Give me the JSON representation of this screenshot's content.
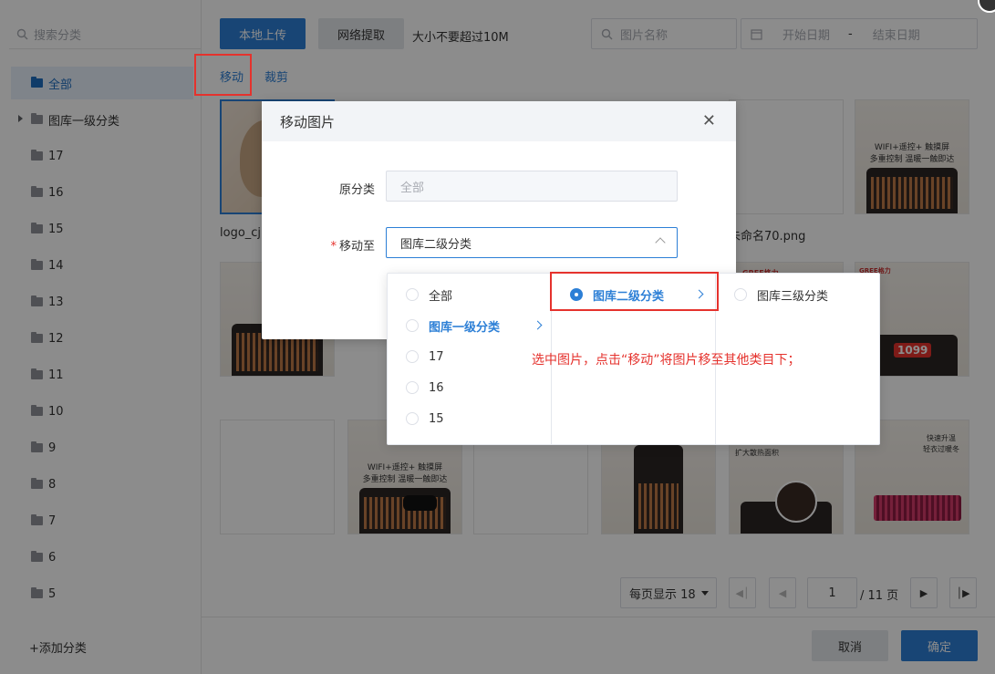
{
  "sidebar": {
    "search_placeholder": "搜索分类",
    "categories": [
      {
        "label": "全部",
        "active": true
      },
      {
        "label": "图库一级分类",
        "expandable": true
      },
      {
        "label": "17"
      },
      {
        "label": "16"
      },
      {
        "label": "15"
      },
      {
        "label": "14"
      },
      {
        "label": "13"
      },
      {
        "label": "12"
      },
      {
        "label": "11"
      },
      {
        "label": "10"
      },
      {
        "label": "9"
      },
      {
        "label": "8"
      },
      {
        "label": "7"
      },
      {
        "label": "6"
      },
      {
        "label": "5"
      }
    ],
    "add_category": "+添加分类"
  },
  "toolbar": {
    "upload_label": "本地上传",
    "fetch_label": "网络提取",
    "size_hint": "大小不要超过10M",
    "image_name_placeholder": "图片名称",
    "start_date_placeholder": "开始日期",
    "date_separator": "-",
    "end_date_placeholder": "结束日期"
  },
  "actions": {
    "move": "移动",
    "crop": "裁剪"
  },
  "thumbnails": {
    "name_1": "logo_cj",
    "name_2": "未命名70.png",
    "heater_caption_line1": "WIFI+遥控+ 触摸屏",
    "heater_caption_line2": "多重控制 温暖一触即达",
    "badge_1099": "1099",
    "brand": "GREE格力",
    "caption_expand": "扩大散热面积",
    "caption_fast_1": "快速升温",
    "caption_fast_2": "轻衣过暖冬"
  },
  "dialog": {
    "title": "移动图片",
    "close_icon": "close-icon",
    "source_label": "原分类",
    "source_value": "全部",
    "target_label": "移动至",
    "target_value": "图库二级分类"
  },
  "cascader": {
    "col1": [
      {
        "label": "全部"
      },
      {
        "label": "图库一级分类",
        "highlight": true
      },
      {
        "label": "17"
      },
      {
        "label": "16"
      },
      {
        "label": "15"
      }
    ],
    "col2": [
      {
        "label": "图库二级分类",
        "checked": true
      }
    ],
    "col3": [
      {
        "label": "图库三级分类"
      }
    ]
  },
  "annotation": "选中图片，点击“移动”将图片移至其他类目下；",
  "pagination": {
    "page_size_label": "每页显示 18",
    "current_page": "1",
    "total_pages": "/ 11 页"
  },
  "footer": {
    "cancel_label": "取消",
    "confirm_label": "确定"
  },
  "colors": {
    "primary": "#2c7fd6",
    "annotation_red": "#e5322d",
    "overlay": "rgba(0,0,0,0.45)"
  }
}
